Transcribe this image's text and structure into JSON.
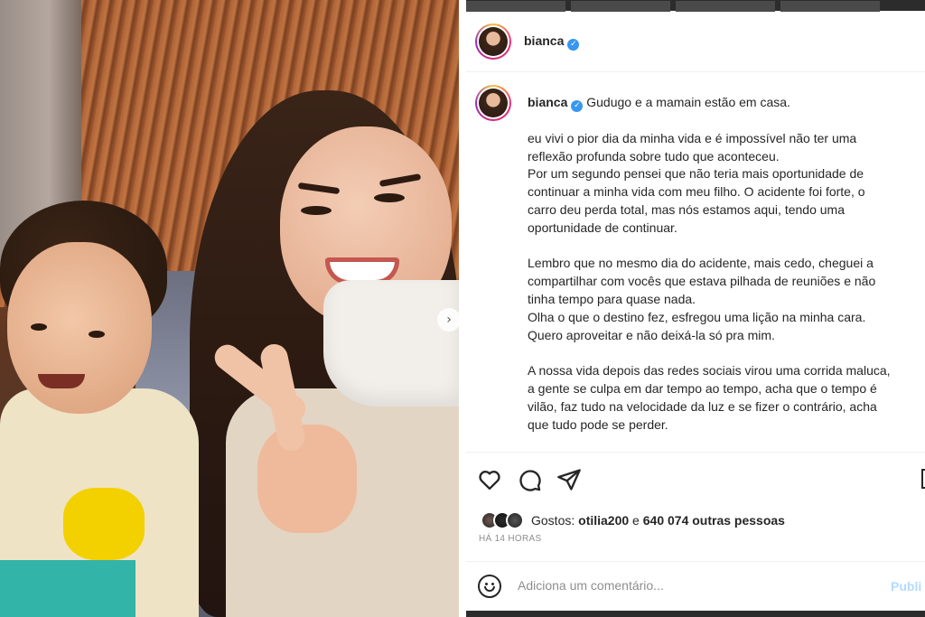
{
  "post": {
    "username": "bianca",
    "caption_lines": [
      "Gudugo e a mamain estão em casa.",
      "",
      "eu vivi o pior dia da minha vida e é impossível não ter uma",
      "reflexão profunda sobre tudo que aconteceu.",
      "Por um segundo pensei que não teria mais oportunidade de",
      "continuar a minha vida com meu filho. O acidente foi forte, o",
      "carro deu perda total, mas nós estamos aqui, tendo uma",
      "oportunidade de continuar.",
      "",
      "Lembro que no mesmo dia do acidente, mais cedo, cheguei a",
      "compartilhar com vocês que estava pilhada de reuniões e não",
      "tinha tempo para quase nada.",
      "Olha o que o destino fez, esfregou uma lição na minha cara.",
      "Quero aproveitar e não deixá-la só pra mim.",
      "",
      "A nossa vida depois das redes sociais virou uma corrida maluca,",
      "a gente se culpa em dar tempo ao tempo, acha que o tempo é",
      "vilão, faz tudo na velocidade da luz e se fizer o contrário, acha",
      "que tudo pode se perder."
    ],
    "likes": {
      "prefix": "Gostos: ",
      "user": "otilia200",
      "connector": " e ",
      "others": "640 074 outras pessoas"
    },
    "timestamp": "HÁ 14 HORAS",
    "comment": {
      "placeholder": "Adiciona um comentário...",
      "publish_label": "Publi"
    }
  },
  "icons": {
    "verified": "verified-badge-icon",
    "more": "more-options-icon",
    "like": "heart-icon",
    "comment": "comment-bubble-icon",
    "share": "paper-plane-icon",
    "save": "bookmark-icon",
    "emoji": "emoji-smile-icon",
    "carousel_next": "chevron-right-icon"
  },
  "colors": {
    "verified": "#3897f0",
    "publish_disabled": "#b3dbff",
    "muted_text": "#8e8e8e"
  }
}
